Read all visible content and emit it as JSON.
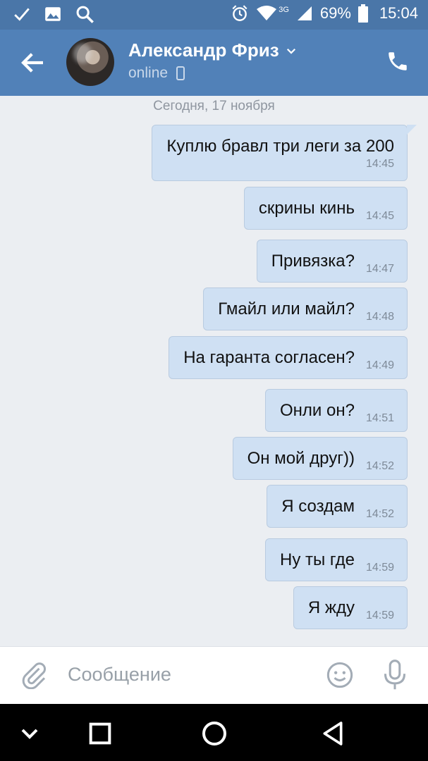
{
  "statusbar": {
    "battery": "69%",
    "time": "15:04",
    "network": "3G",
    "icons": [
      "check-icon",
      "image-icon",
      "search-icon",
      "alarm-icon",
      "wifi-icon",
      "signal-icon",
      "battery-icon"
    ]
  },
  "header": {
    "contact_name": "Александр Фриз",
    "status": "online"
  },
  "chat": {
    "date_separator": "Сегодня, 17 ноября",
    "messages": [
      {
        "text": "Куплю бравл три леги за 200",
        "time": "14:45"
      },
      {
        "text": "скрины кинь",
        "time": "14:45"
      },
      {
        "text": "Привязка?",
        "time": "14:47"
      },
      {
        "text": "Гмайл или майл?",
        "time": "14:48"
      },
      {
        "text": "На гаранта согласен?",
        "time": "14:49"
      },
      {
        "text": "Онли он?",
        "time": "14:51"
      },
      {
        "text": "Он мой друг))",
        "time": "14:52"
      },
      {
        "text": "Я создам",
        "time": "14:52"
      },
      {
        "text": "Ну ты где",
        "time": "14:59"
      },
      {
        "text": "Я жду",
        "time": "14:59"
      }
    ]
  },
  "composer": {
    "placeholder": "Сообщение"
  },
  "colors": {
    "header": "#5181b8",
    "statusbar": "#4a76a8",
    "bubble": "#cfe0f3",
    "background": "#ebeef2"
  }
}
